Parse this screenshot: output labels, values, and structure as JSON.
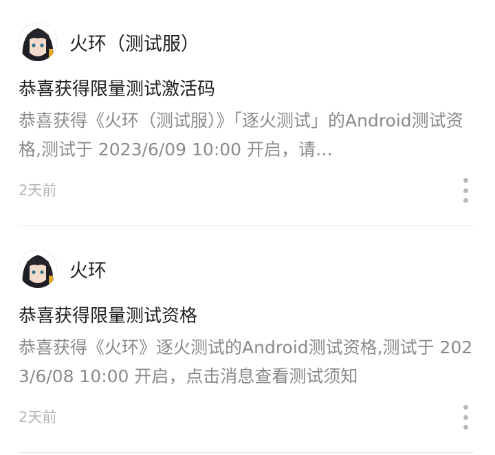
{
  "messages": [
    {
      "avatar_icon": "character-avatar-icon",
      "source": "火环（测试服）",
      "title": "恭喜获得限量测试激活码",
      "body": "恭喜获得《火环（测试服）》「逐火测试」的Android测试资格,测试于 2023/6/09 10:00 开启，请…",
      "time": "2天前",
      "more_icon": "more-vertical-icon"
    },
    {
      "avatar_icon": "character-avatar-icon",
      "source": "火环",
      "title": "恭喜获得限量测试资格",
      "body": "恭喜获得《火环》逐火测试的Android测试资格,测试于 2023/6/08 10:00 开启，点击消息查看测试须知",
      "time": "2天前",
      "more_icon": "more-vertical-icon"
    }
  ]
}
